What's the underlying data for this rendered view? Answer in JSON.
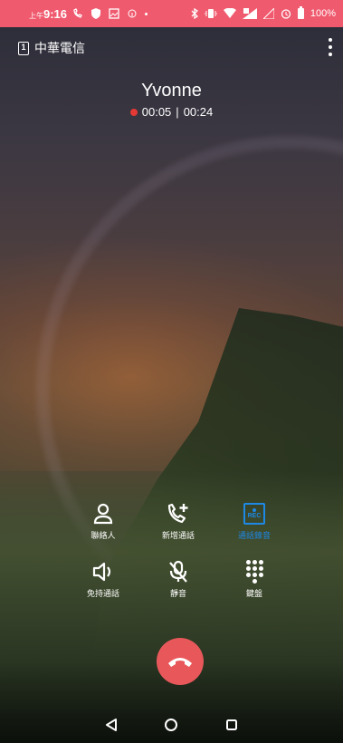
{
  "status_bar": {
    "time_prefix": "上午",
    "time": "9:16",
    "battery": "100%"
  },
  "carrier": {
    "sim_number": "1",
    "name": "中華電信"
  },
  "call": {
    "caller_name": "Yvonne",
    "elapsed": "00:05",
    "separator": "|",
    "recording_time": "00:24"
  },
  "actions": {
    "contacts_label": "聯絡人",
    "add_call_label": "新增通話",
    "record_label": "通話錄音",
    "record_badge": "REC",
    "speaker_label": "免持通話",
    "mute_label": "靜音",
    "keypad_label": "鍵盤"
  },
  "colors": {
    "status_bar": "#f05a6e",
    "accent_blue": "#1e88e5",
    "end_call": "#e8585b",
    "recording_dot": "#e53935"
  }
}
